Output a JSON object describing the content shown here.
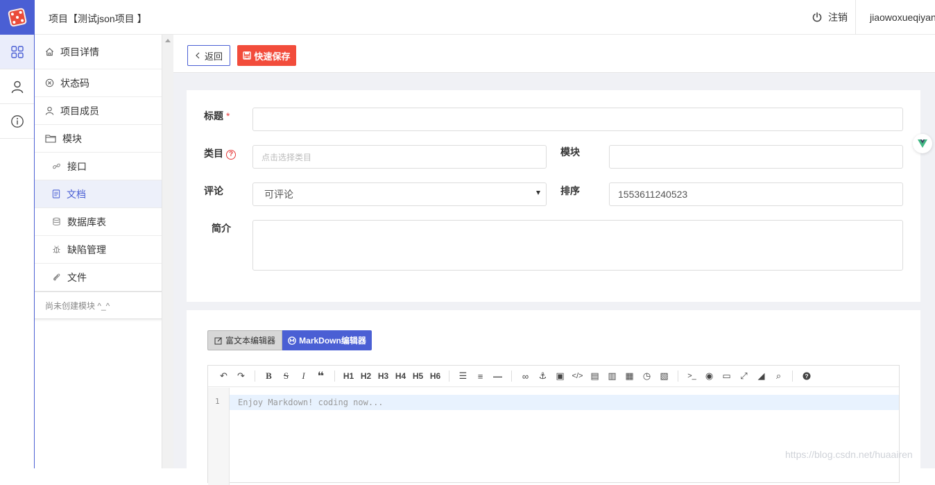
{
  "header": {
    "project_title": "项目【测试json项目 】",
    "logout_label": "注销",
    "username": "jiaowoxueqiyang"
  },
  "rail": {
    "items": [
      "grid-icon",
      "user-icon",
      "info-icon"
    ]
  },
  "sidebar": {
    "items": [
      {
        "label": "项目详情",
        "icon": "home-icon"
      },
      {
        "label": "状态码",
        "icon": "circle-x-icon"
      },
      {
        "label": "项目成员",
        "icon": "user-icon"
      },
      {
        "label": "模块",
        "icon": "folder-icon"
      },
      {
        "label": "接口",
        "icon": "link-icon"
      },
      {
        "label": "文档",
        "icon": "document-icon",
        "active": true
      },
      {
        "label": "数据库表",
        "icon": "database-icon"
      },
      {
        "label": "缺陷管理",
        "icon": "bug-icon"
      },
      {
        "label": "文件",
        "icon": "paperclip-icon"
      }
    ],
    "empty_note": "尚未创建模块 ^_^"
  },
  "toolbar": {
    "back_label": "返回",
    "save_label": "快速保存"
  },
  "form": {
    "title_label": "标题",
    "title_required_mark": "*",
    "title_value": "",
    "category_label": "类目",
    "category_help": "?",
    "category_placeholder": "点击选择类目",
    "module_label": "模块",
    "module_value": "",
    "comment_label": "评论",
    "comment_value": "可评论",
    "order_label": "排序",
    "order_value": "1553611240523",
    "summary_label": "简介",
    "summary_value": ""
  },
  "editor": {
    "tab_rich_label": "富文本编辑器",
    "tab_md_label": "MarkDown编辑器",
    "active_tab": "MarkDown编辑器",
    "toolbar_headings": [
      "H1",
      "H2",
      "H3",
      "H4",
      "H5",
      "H6"
    ],
    "line_number": "1",
    "placeholder_line": "Enjoy Markdown! coding now..."
  },
  "watermark": "https://blog.csdn.net/huaairen",
  "colors": {
    "accent": "#4a5fd4",
    "danger": "#f24c3b",
    "background": "#f0f1f5"
  }
}
